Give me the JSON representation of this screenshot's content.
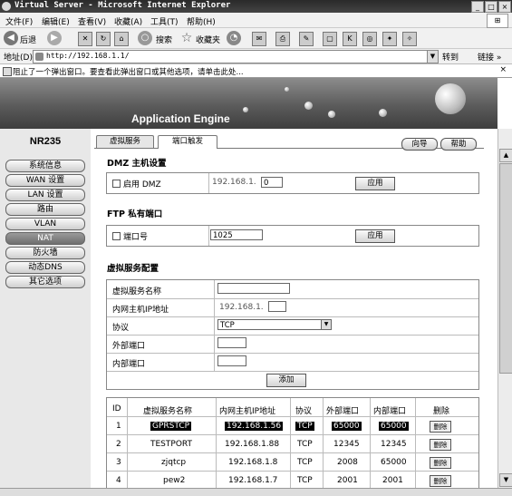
{
  "window": {
    "title": "Virtual Server - Microsoft Internet Explorer",
    "min": "_",
    "max": "□",
    "close": "×"
  },
  "menu": {
    "file": "文件(F)",
    "edit": "编辑(E)",
    "view": "查看(V)",
    "favorites": "收藏(A)",
    "tools": "工具(T)",
    "help": "帮助(H)"
  },
  "toolbar": {
    "back": "后退",
    "search": "搜索",
    "favorites": "收藏夹"
  },
  "address": {
    "label": "地址(D)",
    "url": "http://192.168.1.1/",
    "go": "转到",
    "links": "链接 »"
  },
  "popup_notice": "阻止了一个弹出窗口。要查看此弹出窗口或其他选项，请单击此处...",
  "banner": {
    "app_name": "Application Engine"
  },
  "sidebar": {
    "model": "NR235",
    "items": [
      {
        "label": "系统信息"
      },
      {
        "label": "WAN 设置"
      },
      {
        "label": "LAN 设置"
      },
      {
        "label": "路由"
      },
      {
        "label": "VLAN"
      },
      {
        "label": "NAT"
      },
      {
        "label": "防火墙"
      },
      {
        "label": "动态DNS"
      },
      {
        "label": "其它选项"
      }
    ]
  },
  "tabs": [
    {
      "label": "虚拟服务"
    },
    {
      "label": "端口触发"
    }
  ],
  "header_buttons": {
    "wizard": "向导",
    "help": "帮助"
  },
  "dmz": {
    "title": "DMZ 主机设置",
    "enable_label": "启用 DMZ",
    "ip_prefix": "192.168.1.",
    "ip_value": "0",
    "apply": "应用"
  },
  "ftp": {
    "title": "FTP 私有端口",
    "port_label": "端口号",
    "port_value": "1025",
    "apply": "应用"
  },
  "vserver": {
    "title": "虚拟服务配置",
    "name_label": "虚拟服务名称",
    "ip_label": "内网主机IP地址",
    "ip_prefix": "192.168.1.",
    "protocol_label": "协议",
    "protocol_value": "TCP",
    "ext_port_label": "外部端口",
    "int_port_label": "内部端口",
    "add": "添加"
  },
  "table": {
    "headers": [
      "ID",
      "虚拟服务名称",
      "内网主机IP地址",
      "协议",
      "外部端口",
      "内部端口",
      "删除"
    ],
    "rows": [
      {
        "id": "1",
        "name": "GPRSTCP",
        "ip": "192.168.1.56",
        "proto": "TCP",
        "ext": "65000",
        "int": "65000",
        "del": "删除"
      },
      {
        "id": "2",
        "name": "TESTPORT",
        "ip": "192.168.1.88",
        "proto": "TCP",
        "ext": "12345",
        "int": "12345",
        "del": "删除"
      },
      {
        "id": "3",
        "name": "zjqtcp",
        "ip": "192.168.1.8",
        "proto": "TCP",
        "ext": "2008",
        "int": "65000",
        "del": "删除"
      },
      {
        "id": "4",
        "name": "pew2",
        "ip": "192.168.1.7",
        "proto": "TCP",
        "ext": "2001",
        "int": "2001",
        "del": "删除"
      }
    ]
  }
}
